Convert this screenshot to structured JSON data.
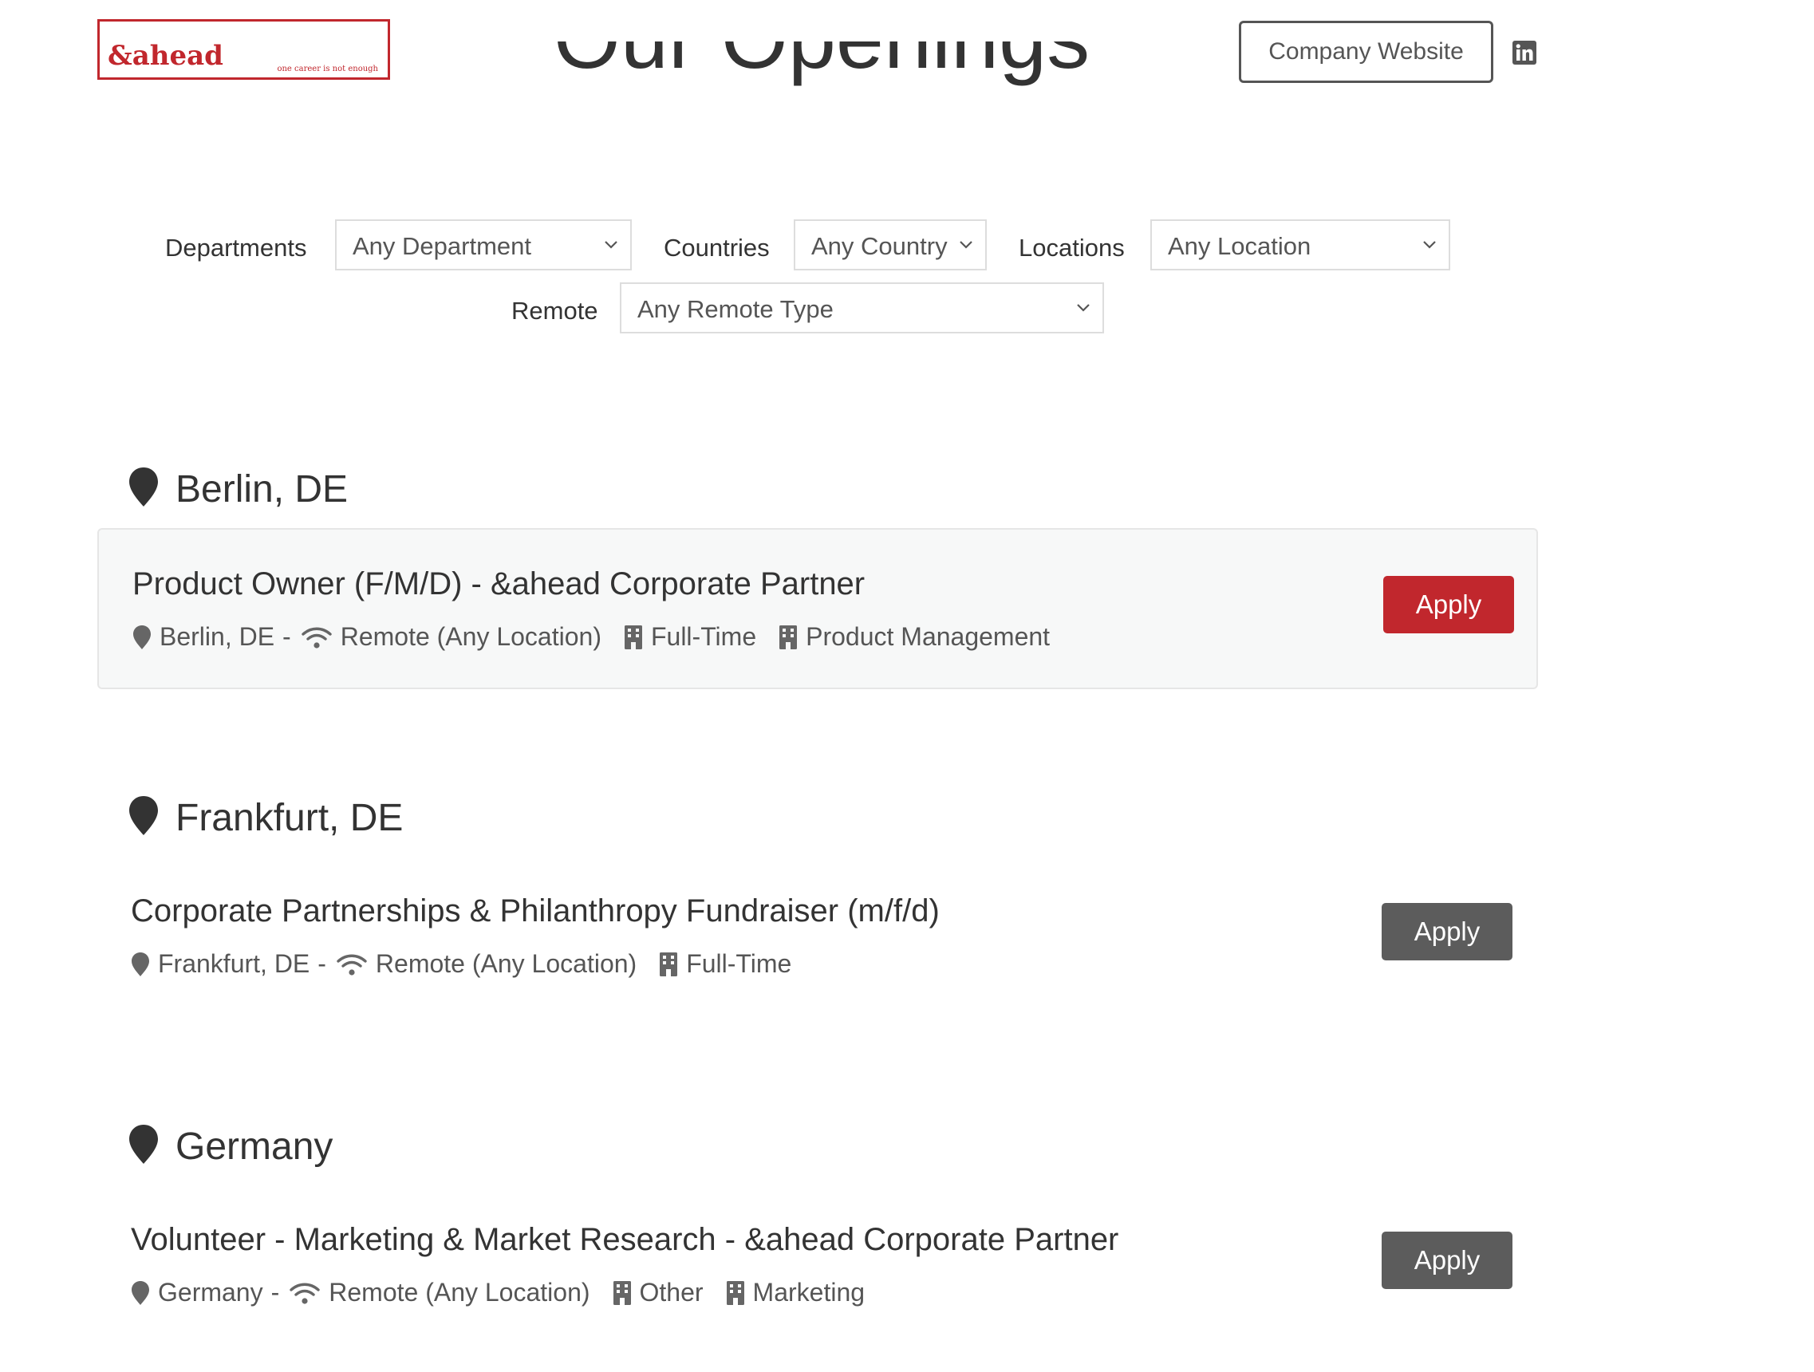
{
  "header": {
    "logo_text": "&ahead",
    "logo_tagline": "one career is not enough",
    "website_button": "Company Website",
    "social_icon": "linkedin-icon"
  },
  "page_title": "Our Openings",
  "filters": {
    "departments": {
      "label": "Departments",
      "value": "Any Department"
    },
    "countries": {
      "label": "Countries",
      "value": "Any Country"
    },
    "locations": {
      "label": "Locations",
      "value": "Any Location"
    },
    "remote": {
      "label": "Remote",
      "value": "Any Remote Type"
    }
  },
  "colors": {
    "brand": "#c1272d",
    "apply_primary": "#c1272d",
    "apply_secondary": "#5c5c5c",
    "text": "#333333",
    "meta_text": "#555555"
  },
  "groups": [
    {
      "location": "Berlin, DE",
      "jobs": [
        {
          "title": "Product Owner (F/M/D) - &ahead Corporate Partner",
          "location": "Berlin, DE",
          "remote": "Remote (Any Location)",
          "type": "Full-Time",
          "department": "Product Management",
          "apply_label": "Apply"
        }
      ]
    },
    {
      "location": "Frankfurt, DE",
      "jobs": [
        {
          "title": "Corporate Partnerships & Philanthropy Fundraiser (m/f/d)",
          "location": "Frankfurt, DE",
          "remote": "Remote (Any Location)",
          "type": "Full-Time",
          "apply_label": "Apply"
        }
      ]
    },
    {
      "location": "Germany",
      "jobs": [
        {
          "title": "Volunteer - Marketing & Market Research - &ahead Corporate Partner",
          "location": "Germany",
          "remote": "Remote (Any Location)",
          "type": "Other",
          "department": "Marketing",
          "apply_label": "Apply"
        }
      ]
    }
  ]
}
